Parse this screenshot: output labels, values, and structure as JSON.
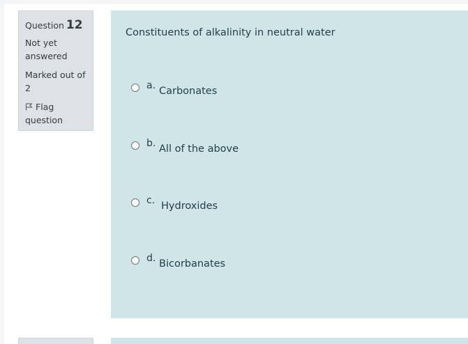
{
  "question": {
    "label": "Question",
    "number": "12",
    "state": "Not yet answered",
    "grade": "Marked out of 2",
    "flag_label": "Flag question",
    "text": "Constituents of alkalinity in neutral water"
  },
  "answers": [
    {
      "letter": "a.",
      "text": "Carbonates"
    },
    {
      "letter": "b.",
      "text": "All of the above"
    },
    {
      "letter": "c.",
      "text": "Hydroxides"
    },
    {
      "letter": "d.",
      "text": "Bicorbanates"
    }
  ],
  "icons": {
    "flag": "flag-icon",
    "radio": "radio-icon"
  },
  "colors": {
    "info_bg": "#dee2e6",
    "content_bg": "#cfe5e8",
    "text": "#23404a"
  }
}
